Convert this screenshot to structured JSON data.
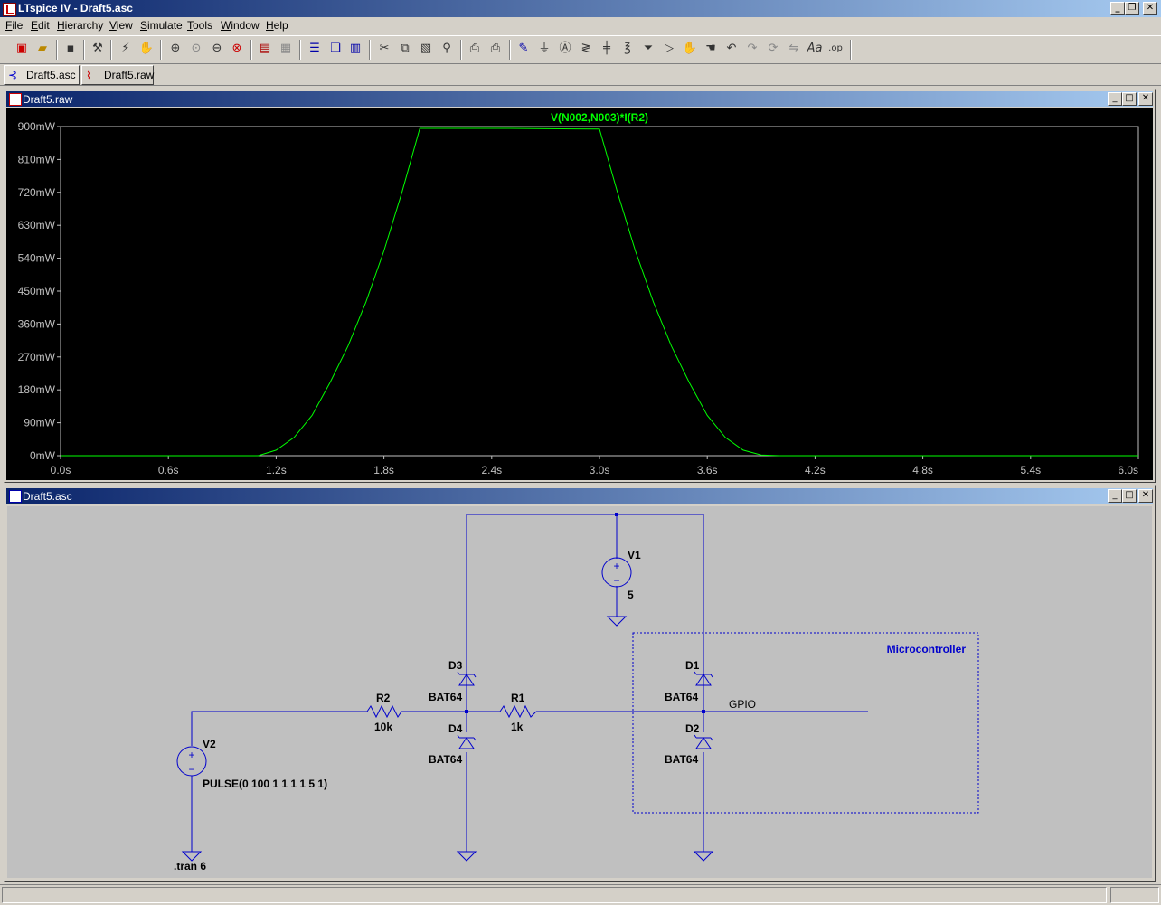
{
  "window": {
    "title": "LTspice IV - Draft5.asc"
  },
  "menu": [
    "File",
    "Edit",
    "Hierarchy",
    "View",
    "Simulate",
    "Tools",
    "Window",
    "Help"
  ],
  "toolbar": [
    "new-schematic-icon",
    "open-icon",
    "save-icon",
    "control-panel-icon",
    "run-icon",
    "halt-icon",
    "zoom-in-icon",
    "zoom-pan-icon",
    "zoom-out-icon",
    "zoom-cancel-icon",
    "autorange-icon",
    "grid-icon",
    "tile-horizontal-icon",
    "cascade-icon",
    "tile-vertical-icon",
    "cut-icon",
    "copy-icon",
    "paste-icon",
    "find-icon",
    "print-setup-icon",
    "print-icon",
    "draw-wire-icon",
    "ground-icon",
    "label-net-icon",
    "resistor-icon",
    "capacitor-icon",
    "inductor-icon",
    "diode-icon",
    "component-icon",
    "move-icon",
    "drag-icon",
    "undo-icon",
    "redo-icon",
    "rotate-icon",
    "mirror-icon",
    "text-icon",
    "spice-directive-icon"
  ],
  "tabs": [
    {
      "label": "Draft5.asc",
      "icon": "schematic-icon"
    },
    {
      "label": "Draft5.raw",
      "icon": "waveform-icon"
    }
  ],
  "waveform_window": {
    "title": "Draft5.raw"
  },
  "schematic_window": {
    "title": "Draft5.asc"
  },
  "colors": {
    "trace": "#00ff00",
    "plot_bg": "#000000",
    "schematic_bg": "#c0c0c0",
    "wire": "#0000cc"
  },
  "chart_data": {
    "type": "line",
    "title": "V(N002,N003)*I(R2)",
    "xlabel": "",
    "ylabel": "",
    "x_ticks": [
      "0.0s",
      "0.6s",
      "1.2s",
      "1.8s",
      "2.4s",
      "3.0s",
      "3.6s",
      "4.2s",
      "4.8s",
      "5.4s",
      "6.0s"
    ],
    "y_ticks": [
      "900mW",
      "810mW",
      "720mW",
      "630mW",
      "540mW",
      "450mW",
      "360mW",
      "270mW",
      "180mW",
      "90mW",
      "0mW"
    ],
    "xlim": [
      0,
      6
    ],
    "ylim": [
      0,
      900
    ],
    "series": [
      {
        "name": "V(N002,N003)*I(R2)",
        "x": [
          0,
          1.0,
          1.1,
          1.2,
          1.3,
          1.4,
          1.5,
          1.6,
          1.7,
          1.8,
          1.9,
          2.0,
          2.5,
          3.0,
          3.1,
          3.2,
          3.3,
          3.4,
          3.5,
          3.6,
          3.7,
          3.8,
          3.9,
          4.0,
          6.0
        ],
        "y": [
          0,
          0,
          0,
          15,
          50,
          110,
          200,
          300,
          420,
          560,
          720,
          895,
          895,
          893,
          720,
          560,
          420,
          300,
          200,
          110,
          50,
          15,
          2,
          0,
          0
        ]
      }
    ]
  },
  "schematic": {
    "labels": {
      "v1_name": "V1",
      "v1_value": "5",
      "v2_name": "V2",
      "v2_value": "PULSE(0 100 1 1 1 1 5 1)",
      "r1_name": "R1",
      "r1_value": "1k",
      "r2_name": "R2",
      "r2_value": "10k",
      "d1_name": "D1",
      "d1_value": "BAT64",
      "d2_name": "D2",
      "d2_value": "BAT64",
      "d3_name": "D3",
      "d3_value": "BAT64",
      "d4_name": "D4",
      "d4_value": "BAT64",
      "net_gpio": "GPIO",
      "box_label": "Microcontroller",
      "directive": ".tran 6"
    }
  }
}
